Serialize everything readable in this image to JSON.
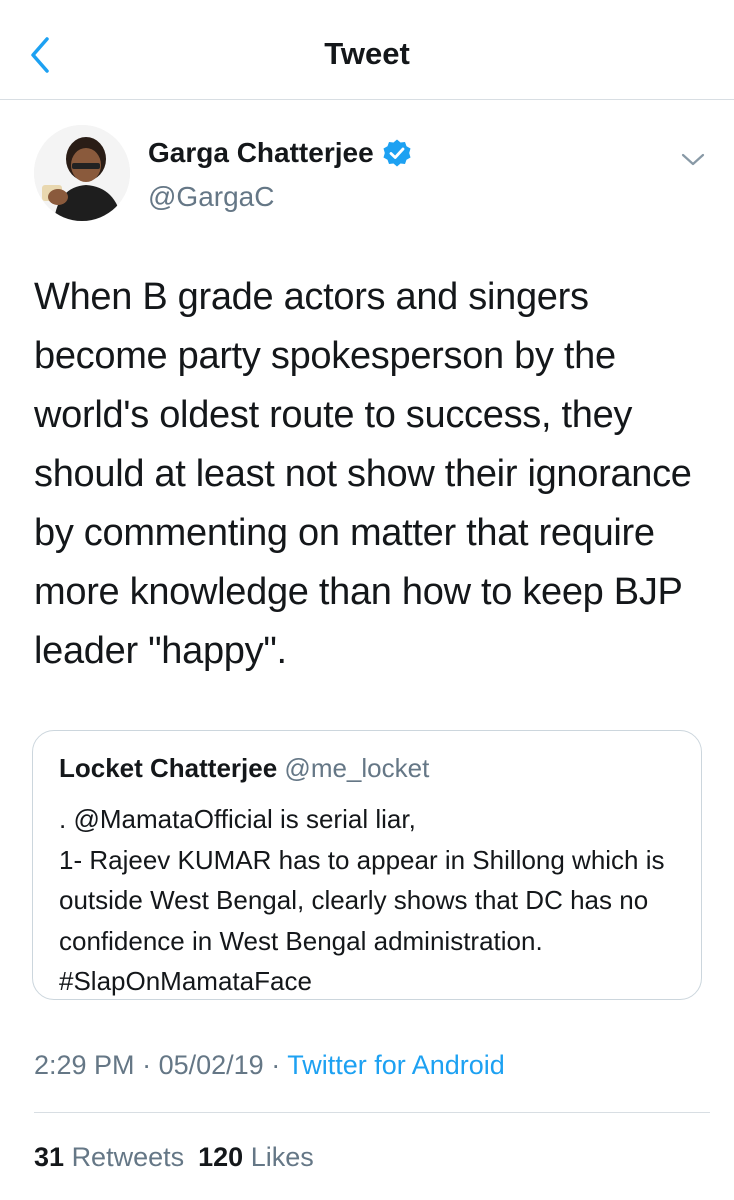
{
  "nav": {
    "title": "Tweet"
  },
  "tweet": {
    "author_name": "Garga Chatterjee",
    "author_handle": "@GargaC",
    "text": "When B grade actors and singers become party spokesperson by the world's oldest route to success, they should at least not show their ignorance by commenting on matter that require more knowledge than how to keep BJP leader \"happy\".",
    "time": "2:29 PM",
    "date": "05/02/19",
    "source": "Twitter for Android",
    "retweets_count": "31",
    "retweets_label": "Retweets",
    "likes_count": "120",
    "likes_label": "Likes"
  },
  "quoted": {
    "author_name": "Locket Chatterjee",
    "author_handle": "@me_locket",
    "text": ". @MamataOfficial is serial liar,\n1- Rajeev KUMAR has to appear in Shillong which is outside West Bengal, clearly shows that DC has no confidence in West Bengal administration.  #SlapOnMamataFace"
  },
  "icons": {
    "back": "chevron-left-icon",
    "verified": "verified-badge-icon",
    "more": "chevron-down-icon"
  },
  "colors": {
    "accent": "#1da1f2",
    "text": "#14171a",
    "secondary": "#657786",
    "border": "#ccd6dd"
  }
}
